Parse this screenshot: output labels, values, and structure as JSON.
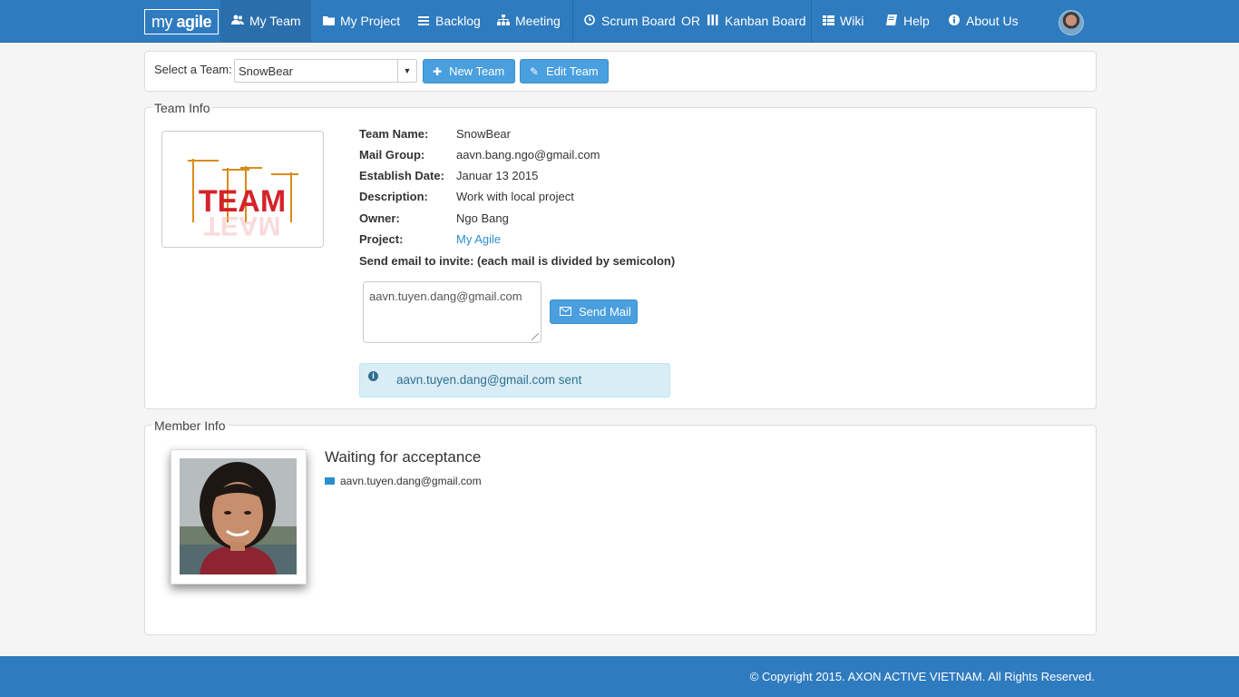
{
  "nav": {
    "logo": {
      "prefix": "my ",
      "brand": "agile"
    },
    "items": [
      {
        "label": "My Team",
        "icon": "users-icon",
        "glyph": "👥"
      },
      {
        "label": "My Project",
        "icon": "folder-icon",
        "glyph": "▆"
      },
      {
        "label": "Backlog",
        "icon": "list-icon",
        "glyph": "☰"
      },
      {
        "label": "Meeting",
        "icon": "sitemap-icon",
        "glyph": "⚇"
      },
      {
        "label": "Scrum Board",
        "icon": "clock-icon",
        "glyph": "◷"
      },
      {
        "label": "Kanban Board",
        "icon": "columns-icon",
        "glyph": "Ⅲ"
      },
      {
        "label": "Wiki",
        "icon": "table-icon",
        "glyph": "▦"
      },
      {
        "label": "Help",
        "icon": "book-icon",
        "glyph": "▰"
      },
      {
        "label": "About Us",
        "icon": "info-icon",
        "glyph": "ⓘ"
      }
    ],
    "or_text": "OR"
  },
  "team_selector": {
    "label": "Select a Team:",
    "selected": "SnowBear",
    "new_team": "New Team",
    "edit_team": "Edit Team"
  },
  "team_info": {
    "legend": "Team Info",
    "team_name_key": "Team Name:",
    "team_name": "SnowBear",
    "mail_group_key": "Mail Group:",
    "mail_group": "aavn.bang.ngo@gmail.com",
    "establish_key": "Establish Date:",
    "establish_date": "Januar 13 2015",
    "description_key": "Description:",
    "description": "Work with local project",
    "owner_key": "Owner:",
    "owner": "Ngo Bang",
    "project_key": "Project:",
    "project": "My Agile",
    "invite_label": "Send email to invite: (each mail is divided by semicolon)",
    "invite_value": "aavn.tuyen.dang@gmail.com",
    "send_mail": "Send Mail",
    "alert_message": "aavn.tuyen.dang@gmail.com sent",
    "image_text": "TEAM"
  },
  "member_info": {
    "legend": "Member Info",
    "status_title": "Waiting for acceptance",
    "email": "aavn.tuyen.dang@gmail.com"
  },
  "footer": {
    "copyright": "© Copyright 2015. AXON ACTIVE VIETNAM. All Rights Reserved."
  },
  "colors": {
    "navbar": "#2f7bbf",
    "button": "#4a9fdf",
    "link": "#2a8fcf",
    "alert_bg": "#d9edf7",
    "alert_text": "#31708f"
  }
}
